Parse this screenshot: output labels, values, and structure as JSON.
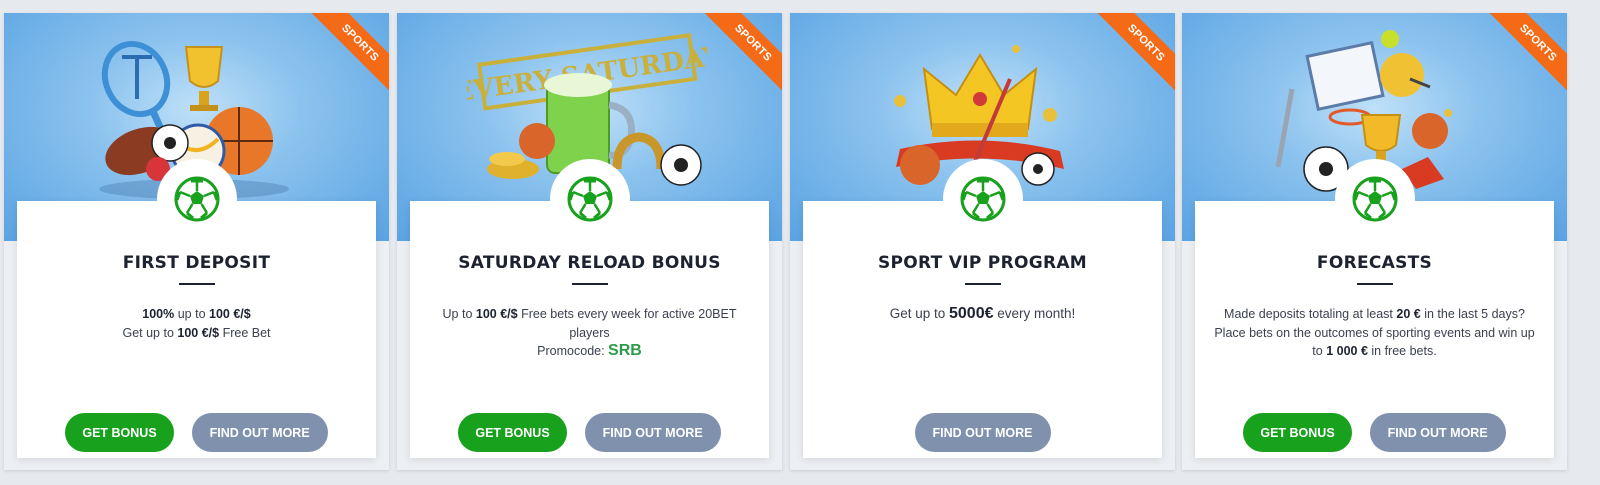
{
  "ribbon_label": "SPORTS",
  "colors": {
    "accent_green": "#18a11c",
    "button_grey": "#7f91ad",
    "ribbon_orange": "#f46a17",
    "banner_blue": "#5aa3e3"
  },
  "cards": [
    {
      "title": "FIRST DEPOSIT",
      "desc_line1_a": "100%",
      "desc_line1_b": " up to ",
      "desc_line1_c": "100 €/$",
      "desc_line2_a": "Get up to ",
      "desc_line2_b": "100 €/$",
      "desc_line2_c": " Free Bet",
      "get_bonus": "GET BONUS",
      "find_out_more": "FIND OUT MORE"
    },
    {
      "title": "SATURDAY RELOAD BONUS",
      "banner_text": "EVERY SATURDAY",
      "desc_a": "Up to ",
      "desc_b": "100 €/$",
      "desc_c": " Free bets every week for active 20BET players",
      "promo_label": "Promocode: ",
      "promo_code": "SRB",
      "get_bonus": "GET BONUS",
      "find_out_more": "FIND OUT MORE"
    },
    {
      "title": "SPORT VIP PROGRAM",
      "desc_a": "Get up to ",
      "desc_b": "5000€",
      "desc_c": " every month!",
      "find_out_more": "FIND OUT MORE"
    },
    {
      "title": "FORECASTS",
      "desc_a": "Made deposits totaling at least ",
      "desc_b": "20 €",
      "desc_c": " in the last 5 days? Place bets on the outcomes of sporting events and win up to ",
      "desc_d": "1 000 €",
      "desc_e": " in free bets.",
      "get_bonus": "GET BONUS",
      "find_out_more": "FIND OUT MORE"
    }
  ]
}
